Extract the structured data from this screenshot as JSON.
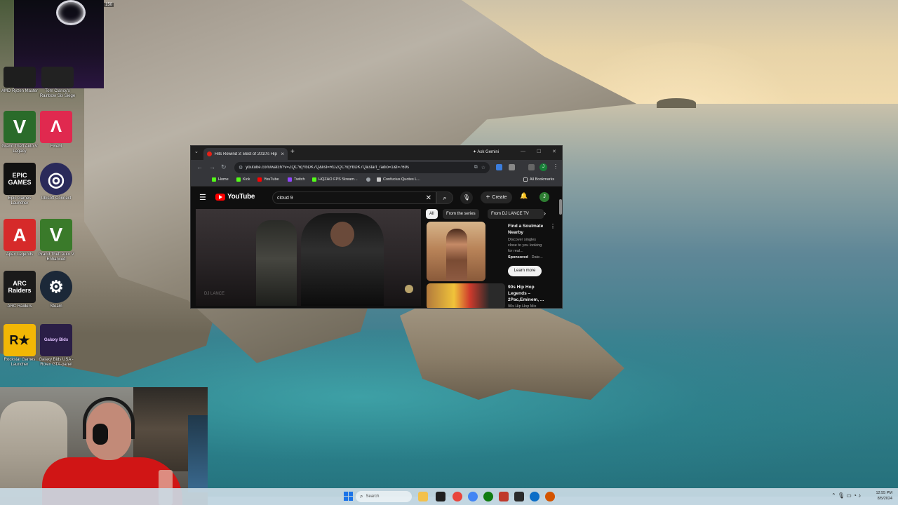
{
  "desktop": {
    "icons": [
      {
        "label": "AMD Ryzen Master",
        "tile_color": "#1e1e1e",
        "icon": "amd-icon"
      },
      {
        "label": "Tom Clancy's Rainbow Six Siege",
        "tile_color": "#222",
        "icon": "r6-icon"
      },
      {
        "label": "Grand Theft Auto V Legacy",
        "tile_color": "#2a6b2a",
        "icon": "gta-icon",
        "glyph": "V"
      },
      {
        "label": "FiveM",
        "tile_color": "#e0294f",
        "icon": "fivem-icon",
        "glyph": "Λ"
      },
      {
        "label": "Epic Games Launcher",
        "tile_color": "#111111",
        "icon": "epic-icon",
        "glyph": "EPIC GAMES"
      },
      {
        "label": "Ubisoft Connect",
        "tile_color": "#2a2a5a",
        "icon": "ubisoft-icon",
        "glyph": "◎"
      },
      {
        "label": "Apex Legends",
        "tile_color": "#d62a2a",
        "icon": "apex-icon",
        "glyph": "A"
      },
      {
        "label": "Grand Theft Auto V Enhanced",
        "tile_color": "#3a7a2a",
        "icon": "gta-enhanced-icon",
        "glyph": "V"
      },
      {
        "label": "ARC Raiders",
        "tile_color": "#1a1a1a",
        "icon": "arc-icon",
        "glyph": "ARC Raiders"
      },
      {
        "label": "Steam",
        "tile_color": "#1b2838",
        "icon": "steam-icon",
        "glyph": "⚙"
      },
      {
        "label": "Rockstar Games Launcher",
        "tile_color": "#f2b705",
        "icon": "rockstar-icon",
        "glyph": "R★"
      },
      {
        "label": "Galaxy Bids USA - Rolex GTA-panel",
        "tile_color": "#2a1e46",
        "icon": "galaxy-icon",
        "glyph": "Galaxy Bids"
      }
    ],
    "ammo_counter": "150"
  },
  "browser": {
    "tab_title": "Hits Rewind 3: Best of 2010's Hip",
    "ask_gemini": "Ask Gemini",
    "url": "youtube.com/watch?v=ZQCYqYbDK7Q&list=RDZQCYqYbDK7Q&start_radio=1&t=769s",
    "bookmarks": [
      {
        "label": "Home",
        "color": "#53fc18"
      },
      {
        "label": "Kick",
        "color": "#53fc18"
      },
      {
        "label": "YouTube",
        "color": "#ff0000"
      },
      {
        "label": "Twitch",
        "color": "#9146ff"
      },
      {
        "label": "HQZAO FPS Stream...",
        "color": "#53fc18"
      },
      {
        "label": "",
        "color": "#9aa0a6"
      },
      {
        "label": "Confucius Quotes L...",
        "color": "#c9c9c9"
      }
    ],
    "all_bookmarks": "All Bookmarks",
    "profile_initial": "J"
  },
  "youtube": {
    "logo_text": "YouTube",
    "search_value": "cloud 9",
    "create_label": "Create",
    "avatar_initial": "J",
    "player_watermark": "DJ LANCE",
    "chips": [
      "All",
      "From the series",
      "From DJ LANCE TV"
    ],
    "ad": {
      "title": "Find a Soulmate Nearby",
      "description": "Discover singles close to you looking for real...",
      "sponsored": "Sponsored",
      "advertiser": "Date...",
      "button": "Learn more"
    },
    "recommendation": {
      "title": "90s Hip Hop Legends – 2Pac,Eminem, ...",
      "subtitle": "90s Hip Hop Mix"
    }
  },
  "taskbar": {
    "search_placeholder": "Search",
    "time": "12:55 PM",
    "date": "8/5/2024",
    "apps": [
      {
        "icon": "file-explorer-icon",
        "color": "#f3c14b"
      },
      {
        "icon": "terminal-icon",
        "color": "#1f1f1f"
      },
      {
        "icon": "chrome-icon",
        "color": "#e8453c"
      },
      {
        "icon": "colorful-app-icon",
        "color": "#4285f4"
      },
      {
        "icon": "xbox-icon",
        "color": "#107c10"
      },
      {
        "icon": "game-icon",
        "color": "#c0392b"
      },
      {
        "icon": "media-icon",
        "color": "#2b2b2b"
      },
      {
        "icon": "edge-icon",
        "color": "#0b6ec7"
      },
      {
        "icon": "chrome-alt-icon",
        "color": "#d35400"
      }
    ]
  }
}
